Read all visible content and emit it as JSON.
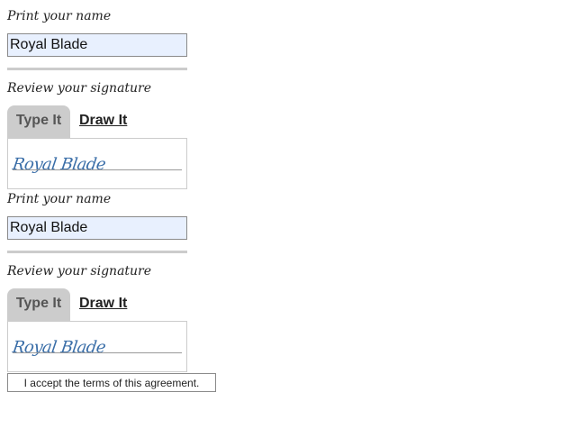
{
  "section1": {
    "print_label": "Print your name",
    "name_value": "Royal Blade",
    "review_label": "Review your signature",
    "tabs": [
      {
        "label": "Type It",
        "active": true
      },
      {
        "label": "Draw It",
        "active": false
      }
    ],
    "signature_text": "Royal Blade"
  },
  "section2": {
    "print_label": "Print your name",
    "name_value": "Royal Blade",
    "review_label": "Review your signature",
    "tabs": [
      {
        "label": "Type It",
        "active": true
      },
      {
        "label": "Draw It",
        "active": false
      }
    ],
    "signature_text": "Royal Blade"
  },
  "accept_button": {
    "label": "I accept the terms of this agreement."
  },
  "colors": {
    "input_bg": "#e8f0fe",
    "tab_active_bg": "#cccccc",
    "signature_ink": "#3a6ea8",
    "divider": "#cccccc"
  }
}
